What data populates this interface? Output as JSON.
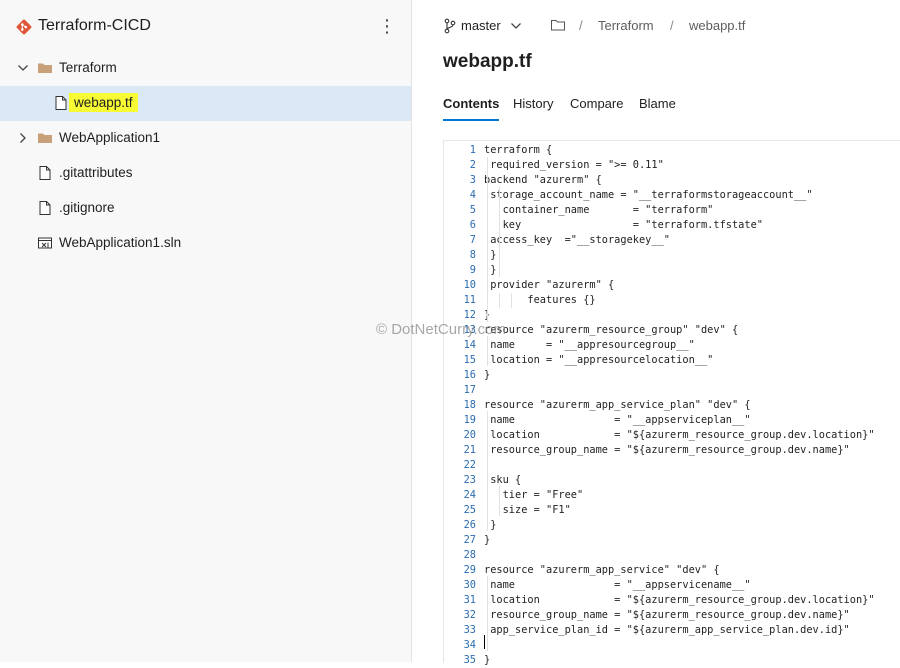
{
  "repo": {
    "name": "Terraform-CICD",
    "more_label": "⋮"
  },
  "tree": [
    {
      "label": "Terraform",
      "type": "folder",
      "expanded": true
    },
    {
      "label": "webapp.tf",
      "type": "file",
      "selected": true
    },
    {
      "label": "WebApplication1",
      "type": "folder",
      "expanded": false
    },
    {
      "label": ".gitattributes",
      "type": "file"
    },
    {
      "label": ".gitignore",
      "type": "file"
    },
    {
      "label": "WebApplication1.sln",
      "type": "solution"
    }
  ],
  "header": {
    "branch": "master",
    "breadcrumb": [
      "Terraform",
      "webapp.tf"
    ],
    "separator": "/"
  },
  "file_title": "webapp.tf",
  "tabs": [
    "Contents",
    "History",
    "Compare",
    "Blame"
  ],
  "active_tab": "Contents",
  "code": [
    "terraform {",
    " required_version = \">= 0.11\"",
    "backend \"azurerm\" {",
    " storage_account_name = \"__terraformstorageaccount__\"",
    "   container_name       = \"terraform\"",
    "   key                  = \"terraform.tfstate\"",
    " access_key  =\"__storagekey__\"",
    " }",
    " }",
    " provider \"azurerm\" {",
    "       features {}",
    "}",
    "resource \"azurerm_resource_group\" \"dev\" {",
    " name     = \"__appresourcegroup__\"",
    " location = \"__appresourcelocation__\"",
    "}",
    "",
    "resource \"azurerm_app_service_plan\" \"dev\" {",
    " name                = \"__appserviceplan__\"",
    " location            = \"${azurerm_resource_group.dev.location}\"",
    " resource_group_name = \"${azurerm_resource_group.dev.name}\"",
    "",
    " sku {",
    "   tier = \"Free\"",
    "   size = \"F1\"",
    " }",
    "}",
    "",
    "resource \"azurerm_app_service\" \"dev\" {",
    " name                = \"__appservicename__\"",
    " location            = \"${azurerm_resource_group.dev.location}\"",
    " resource_group_name = \"${azurerm_resource_group.dev.name}\"",
    " app_service_plan_id = \"${azurerm_app_service_plan.dev.id}\"",
    "",
    "}"
  ],
  "watermark": "© DotNetCurry.com",
  "colors": {
    "accent": "#0078d4",
    "selected_row": "#dbe9f7",
    "highlight": "#f6fb34",
    "line_number": "#2b6cb0"
  }
}
